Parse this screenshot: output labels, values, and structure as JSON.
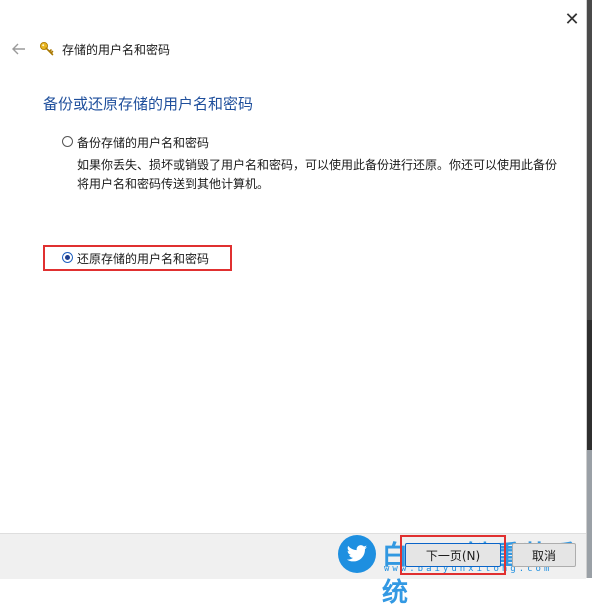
{
  "window": {
    "title": "存储的用户名和密码",
    "close_glyph": "✕",
    "back_glyph": "←"
  },
  "main": {
    "heading": "备份或还原存储的用户名和密码",
    "options": [
      {
        "label": "备份存储的用户名和密码",
        "checked": false,
        "description": "如果你丢失、损坏或销毁了用户名和密码，可以使用此备份进行还原。你还可以使用此备份将用户名和密码传送到其他计算机。"
      },
      {
        "label": "还原存储的用户名和密码",
        "checked": true
      }
    ]
  },
  "footer": {
    "next_label": "下一页(N)",
    "cancel_label": "取消"
  },
  "watermark": {
    "text": "白云一键重装系统",
    "sub": "www.baiyunxitong.com"
  },
  "colors": {
    "heading": "#1f4f9c",
    "highlight": "#e03030",
    "watermark": "#1e8fe0"
  },
  "icons": [
    "close-icon",
    "back-arrow-icon",
    "key-icon",
    "twitter-bird-icon"
  ]
}
